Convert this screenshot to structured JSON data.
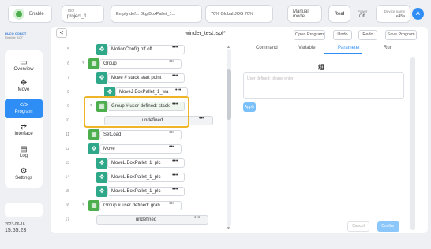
{
  "top": {
    "enable_label": "Enable",
    "tool_label": "Tool",
    "tool_value": "project_1",
    "load_label": "Payload",
    "load_value": "Empty",
    "load_name": "def...",
    "load_weight": "0kg",
    "frame_label": "Frame",
    "frame_value": "BoxPallet_1...",
    "jog_label": "JOG",
    "jog_value": "70%",
    "jog_text": "Global JOG",
    "speed_label": "Global speed",
    "speed_value": "70%",
    "mode": "Manual mode",
    "real": "Real",
    "power_label": "Power",
    "power_value": "Off",
    "device_label": "Device name",
    "device_value": "e45a",
    "avatar": "A"
  },
  "logo": {
    "line1": "DUCO COBOT",
    "line2": "Flexible BOT"
  },
  "nav": [
    {
      "icon": "monitor-icon",
      "glyph": "▭",
      "label": "Overview"
    },
    {
      "icon": "move-icon",
      "glyph": "✥",
      "label": "Move"
    },
    {
      "icon": "code-icon",
      "glyph": "</>",
      "label": "Program"
    },
    {
      "icon": "interface-icon",
      "glyph": "⇄",
      "label": "Interface"
    },
    {
      "icon": "calendar-icon",
      "glyph": "▤",
      "label": "Log"
    },
    {
      "icon": "settings-icon",
      "glyph": "⚙",
      "label": "Settings"
    }
  ],
  "more": "...",
  "datetime": {
    "date": "2023-06-16",
    "time": "15:55:23"
  },
  "header": {
    "back": "<",
    "title": "winder_test.jspf*",
    "btn_open": "Open Program",
    "btn_undo": "Undo",
    "btn_redo": "Redo",
    "btn_save": "Save Program"
  },
  "rows": [
    {
      "no": "5",
      "text": "MotionConfig  off off",
      "indent": 2
    },
    {
      "no": "6",
      "text": "Group",
      "indent": 1
    },
    {
      "no": "7",
      "text": "Move  # stack start point",
      "indent": 2
    },
    {
      "no": "8",
      "text": "MoveJ  BoxPallet_1_wa",
      "indent": 3
    },
    {
      "no": "9",
      "text": "Group  # user defined: stack",
      "indent": 2
    },
    {
      "no": "10",
      "text": "undefined",
      "indent": 3
    },
    {
      "no": "11",
      "text": "SetLoad",
      "indent": 1
    },
    {
      "no": "12",
      "text": "Move",
      "indent": 1
    },
    {
      "no": "13",
      "text": "MoveL  BoxPallet_1_plc",
      "indent": 2
    },
    {
      "no": "14",
      "text": "MoveL  BoxPallet_1_plc",
      "indent": 2
    },
    {
      "no": "15",
      "text": "MoveL  BoxPallet_1_plc",
      "indent": 2
    },
    {
      "no": "16",
      "text": "Group  # user defined: grab",
      "indent": 1
    },
    {
      "no": "17",
      "text": "undefined",
      "indent": 2
    }
  ],
  "tabs": [
    "Command",
    "Variable",
    "Parameter",
    "Run"
  ],
  "panel": {
    "title": "组",
    "placeholder": "User defined: please enter",
    "apply": "Apply",
    "cancel": "Cancel",
    "confirm": "Confirm"
  },
  "colors": {
    "accent": "#2e8ef5",
    "green": "#4cae4c",
    "teal": "#2fa88a",
    "highlight": "#f0b429"
  }
}
